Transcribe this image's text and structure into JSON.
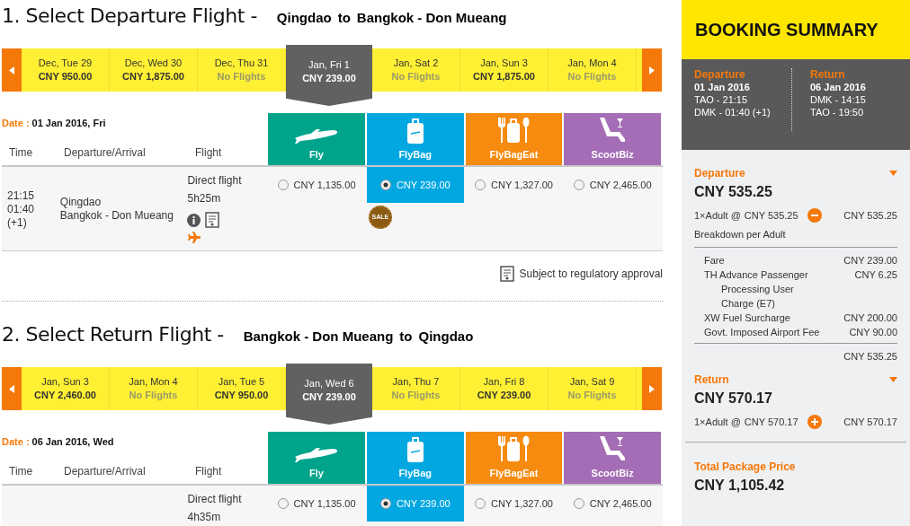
{
  "sections": [
    {
      "heading": "1. Select Departure Flight -",
      "route_from": "Qingdao",
      "route_sep": "to",
      "route_to": "Bangkok - Don Mueang",
      "dates": [
        {
          "day": "Dec, Tue 29",
          "fare": "CNY 950.00",
          "available": true,
          "selected": false
        },
        {
          "day": "Dec, Wed 30",
          "fare": "CNY 1,875.00",
          "available": true,
          "selected": false
        },
        {
          "day": "Dec, Thu 31",
          "fare": "No Flights",
          "available": false,
          "selected": false
        },
        {
          "day": "Jan, Fri 1",
          "fare": "CNY 239.00",
          "available": true,
          "selected": true
        },
        {
          "day": "Jan, Sat 2",
          "fare": "No Flights",
          "available": false,
          "selected": false
        },
        {
          "day": "Jan, Sun 3",
          "fare": "CNY 1,875.00",
          "available": true,
          "selected": false
        },
        {
          "day": "Jan, Mon 4",
          "fare": "No Flights",
          "available": false,
          "selected": false
        }
      ],
      "date_label": "Date :",
      "date_value": "01 Jan 2016, Fri",
      "columns": [
        "Time",
        "Departure/Arrival",
        "Flight"
      ],
      "fare_types": [
        {
          "name": "Fly",
          "kind": "plane",
          "color": "#00a48b"
        },
        {
          "name": "FlyBag",
          "kind": "bag",
          "color": "#00a7e1"
        },
        {
          "name": "FlyBagEat",
          "kind": "meal",
          "color": "#f68b0f"
        },
        {
          "name": "ScootBiz",
          "kind": "seat",
          "color": "#a46db5"
        }
      ],
      "flight": {
        "times": [
          "21:15",
          "01:40",
          "(+1)"
        ],
        "cities": [
          "Qingdao",
          "Bangkok - Don Mueang"
        ],
        "type": "Direct flight",
        "duration": "5h25m",
        "prices": [
          {
            "amount": "CNY 1,135.00",
            "selected": false
          },
          {
            "amount": "CNY 239.00",
            "selected": true,
            "badge": "SALE"
          },
          {
            "amount": "CNY 1,327.00",
            "selected": false
          },
          {
            "amount": "CNY 2,465.00",
            "selected": false
          }
        ]
      },
      "note": "Subject to regulatory approval"
    },
    {
      "heading": "2. Select Return Flight -",
      "route_from": "Bangkok - Don Mueang",
      "route_sep": "to",
      "route_to": "Qingdao",
      "dates": [
        {
          "day": "Jan, Sun 3",
          "fare": "CNY 2,460.00",
          "available": true,
          "selected": false
        },
        {
          "day": "Jan, Mon 4",
          "fare": "No Flights",
          "available": false,
          "selected": false
        },
        {
          "day": "Jan, Tue 5",
          "fare": "CNY 950.00",
          "available": true,
          "selected": false
        },
        {
          "day": "Jan, Wed 6",
          "fare": "CNY 239.00",
          "available": true,
          "selected": true
        },
        {
          "day": "Jan, Thu 7",
          "fare": "No Flights",
          "available": false,
          "selected": false
        },
        {
          "day": "Jan, Fri 8",
          "fare": "CNY 239.00",
          "available": true,
          "selected": false
        },
        {
          "day": "Jan, Sat 9",
          "fare": "No Flights",
          "available": false,
          "selected": false
        }
      ],
      "date_label": "Date :",
      "date_value": "06 Jan 2016, Wed",
      "columns": [
        "Time",
        "Departure/Arrival",
        "Flight"
      ],
      "fare_types": [
        {
          "name": "Fly",
          "kind": "plane",
          "color": "#00a48b"
        },
        {
          "name": "FlyBag",
          "kind": "bag",
          "color": "#00a7e1"
        },
        {
          "name": "FlyBagEat",
          "kind": "meal",
          "color": "#f68b0f"
        },
        {
          "name": "ScootBiz",
          "kind": "seat",
          "color": "#a46db5"
        }
      ],
      "flight": {
        "type": "Direct flight",
        "duration": "4h35m",
        "prices": [
          {
            "amount": "CNY 1,135.00",
            "selected": false
          },
          {
            "amount": "CNY 239.00",
            "selected": true
          },
          {
            "amount": "CNY 1,327.00",
            "selected": false
          },
          {
            "amount": "CNY 2,465.00",
            "selected": false
          }
        ]
      }
    }
  ],
  "summary": {
    "title": "BOOKING SUMMARY",
    "trips": [
      {
        "label": "Departure",
        "date": "01 Jan 2016",
        "lines": [
          "TAO - 21:15",
          "DMK - 01:40 (+1)"
        ]
      },
      {
        "label": "Return",
        "date": "06 Jan 2016",
        "lines": [
          "DMK - 14:15",
          "TAO - 19:50"
        ]
      }
    ],
    "legs": [
      {
        "label": "Departure",
        "total": "CNY 535.25",
        "pax": "1×Adult @",
        "unit": "CNY 535.25",
        "amount": "CNY 535.25",
        "expanded": true,
        "breakdown_title": "Breakdown per Adult",
        "breakdown": [
          {
            "name": "Fare",
            "amount": "CNY 239.00"
          },
          {
            "name": "TH Advance Passenger Processing User Charge (E7)",
            "amount": "CNY 6.25"
          },
          {
            "name": "XW Fuel Surcharge",
            "amount": "CNY 200.00"
          },
          {
            "name": "Govt. Imposed Airport Fee",
            "amount": "CNY 90.00"
          }
        ],
        "breakdown_total": "CNY 535.25"
      },
      {
        "label": "Return",
        "total": "CNY 570.17",
        "pax": "1×Adult @",
        "unit": "CNY 570.17",
        "amount": "CNY 570.17",
        "expanded": false
      }
    ],
    "total_label": "Total Package Price",
    "total": "CNY 1,105.42"
  }
}
